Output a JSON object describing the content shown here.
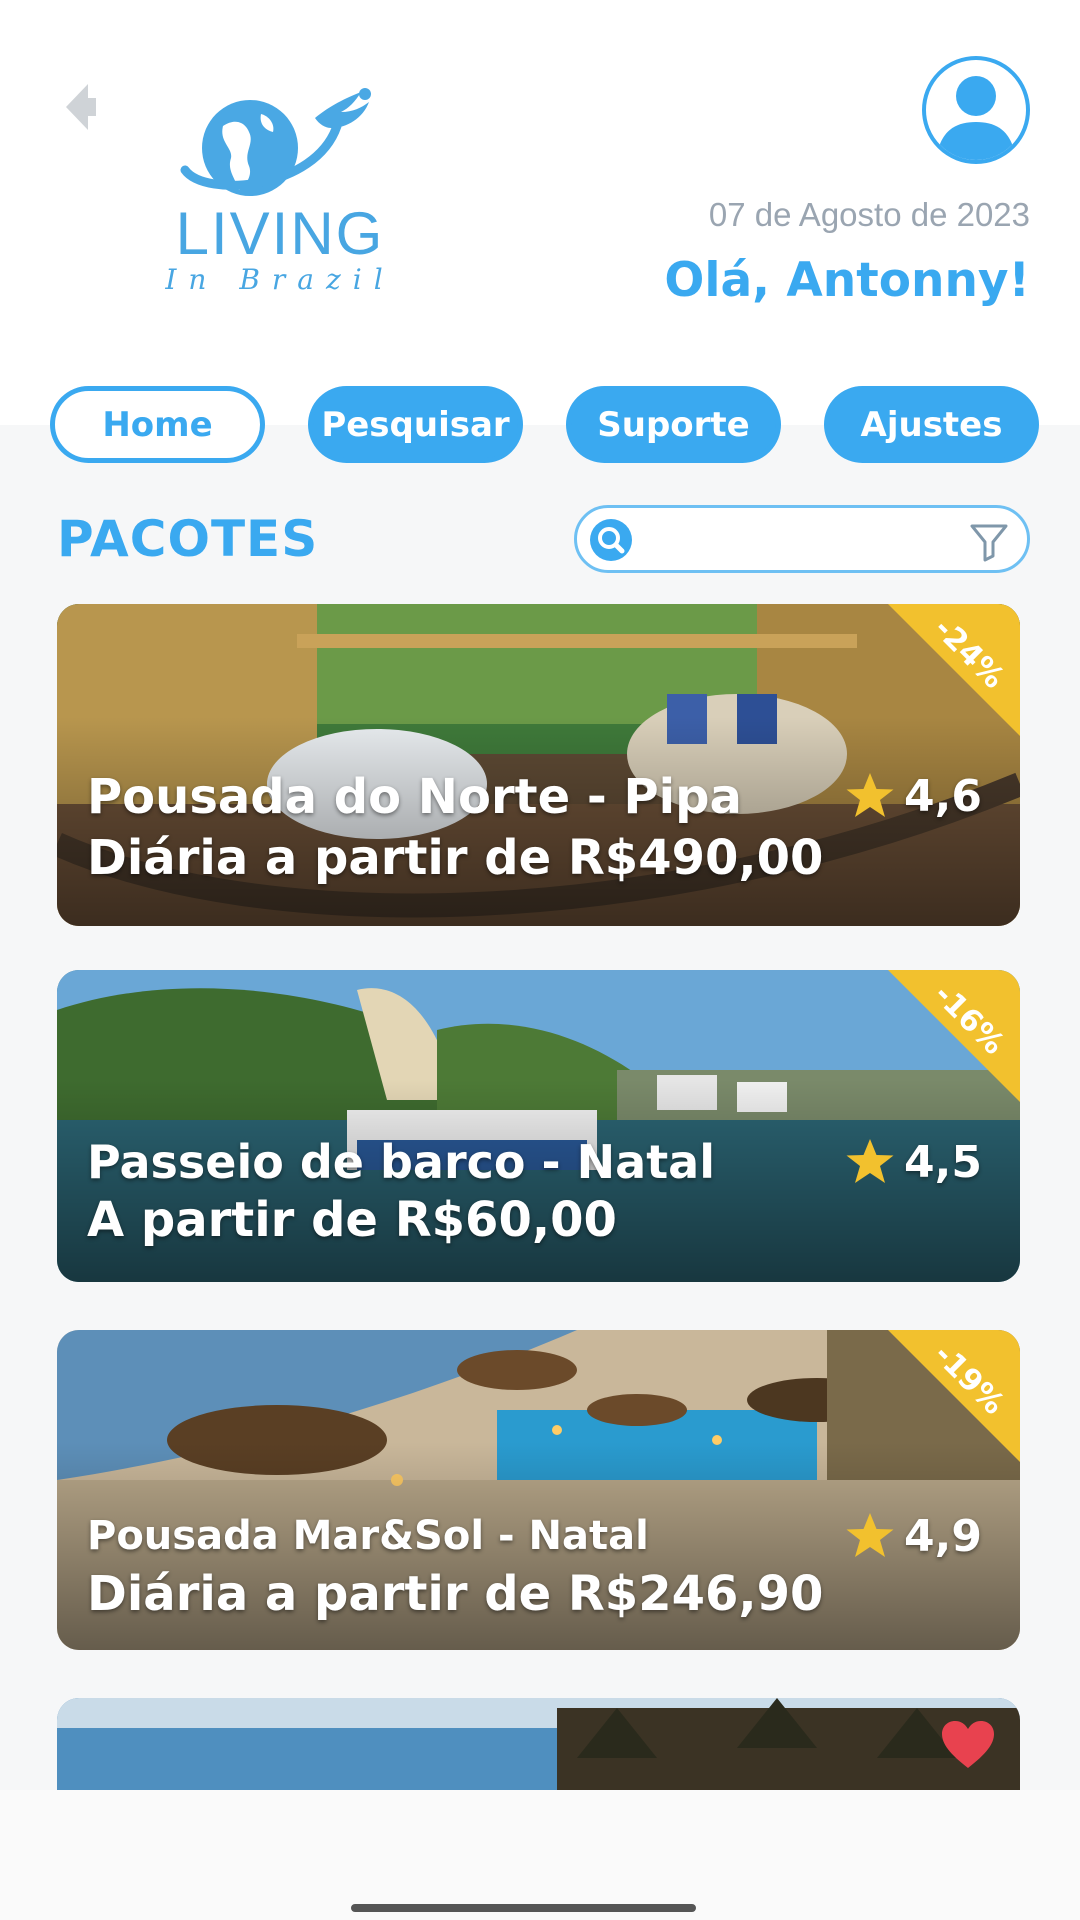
{
  "header": {
    "logo_word": "LIVING",
    "logo_sub": "In Brazil",
    "date": "07 de Agosto de 2023",
    "greeting": "Olá, Antonny!"
  },
  "nav": {
    "tabs": [
      {
        "label": "Home",
        "active": true
      },
      {
        "label": "Pesquisar",
        "active": false
      },
      {
        "label": "Suporte",
        "active": false
      },
      {
        "label": "Ajustes",
        "active": false
      }
    ]
  },
  "section": {
    "title": "PACOTES"
  },
  "search": {
    "value": "",
    "placeholder": ""
  },
  "cards": [
    {
      "title": "Pousada do Norte - Pipa",
      "price": "Diária a partir de R$490,00",
      "rating": "4,6",
      "discount": "-24%"
    },
    {
      "title": "Passeio de barco - Natal",
      "price": "A partir de R$60,00",
      "rating": "4,5",
      "discount": "-16%"
    },
    {
      "title": "Pousada Mar&Sol - Natal",
      "price": "Diária a partir de R$246,90",
      "rating": "4,9",
      "discount": "-19%"
    },
    {
      "favorite": true
    }
  ],
  "colors": {
    "accent": "#3aa9f0",
    "discount_ribbon": "#f2c12e",
    "star": "#f2c12e",
    "heart": "#e8424f",
    "date_text": "#9aa5b1"
  },
  "icons": [
    "back-arrow-icon",
    "globe-bird-logo",
    "user-icon",
    "search-icon",
    "filter-icon",
    "star-icon",
    "heart-icon"
  ]
}
